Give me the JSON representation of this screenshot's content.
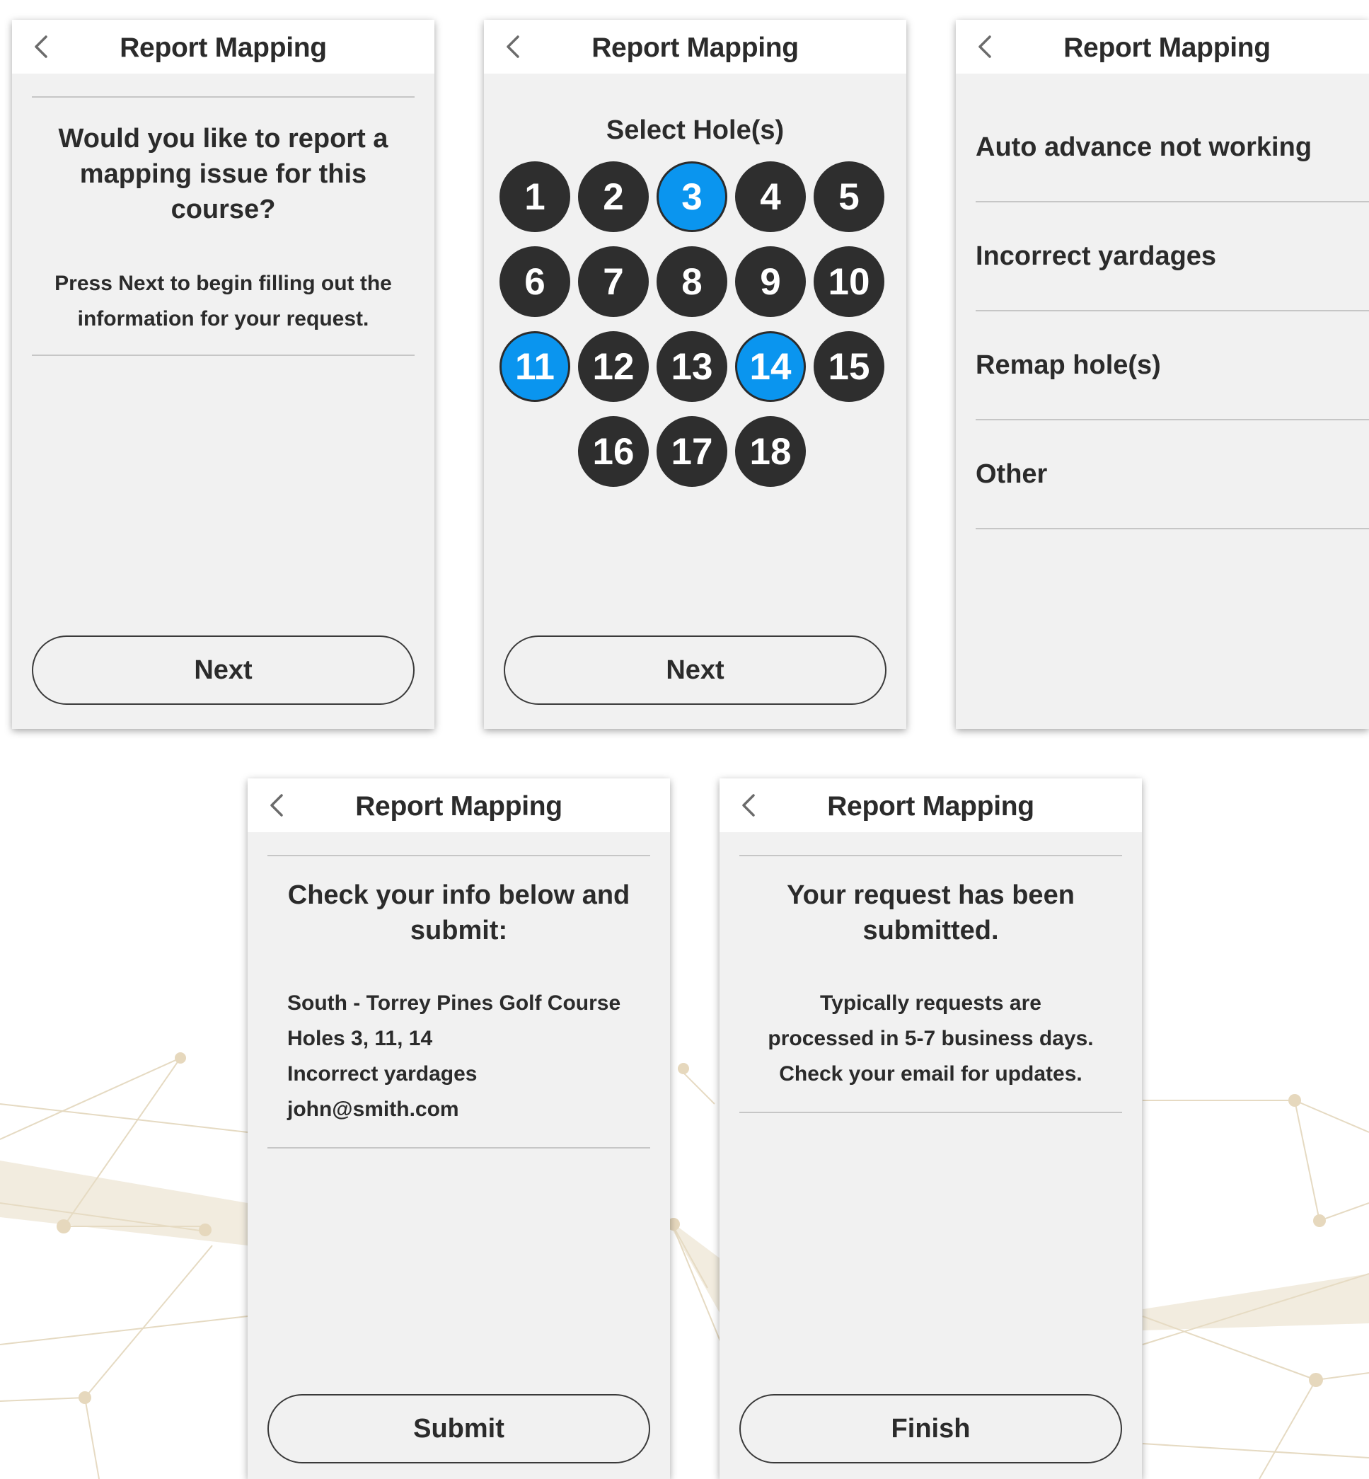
{
  "header_title": "Report Mapping",
  "screen1": {
    "question": "Would you like to report a mapping issue for this course?",
    "instructions": "Press Next to begin filling out the information for your request.",
    "next_label": "Next"
  },
  "screen2": {
    "heading": "Select Hole(s)",
    "holes": [
      "1",
      "2",
      "3",
      "4",
      "5",
      "6",
      "7",
      "8",
      "9",
      "10",
      "11",
      "12",
      "13",
      "14",
      "15",
      "16",
      "17",
      "18"
    ],
    "selected_holes": [
      "3",
      "11",
      "14"
    ],
    "next_label": "Next"
  },
  "screen3": {
    "options": [
      "Auto advance not working",
      "Incorrect yardages",
      "Remap hole(s)",
      "Other"
    ]
  },
  "screen4": {
    "heading": "Check your info below and submit:",
    "course": "South - Torrey Pines Golf Course",
    "holes": "Holes 3, 11, 14",
    "issue": "Incorrect yardages",
    "email": "john@smith.com",
    "submit_label": "Submit"
  },
  "screen5": {
    "heading": "Your request has been submitted.",
    "line1": "Typically requests are",
    "line2": "processed in 5-7 business days.",
    "line3": "Check your email for updates.",
    "finish_label": "Finish"
  },
  "colors": {
    "selected_hole": "#0a95ef",
    "hole": "#2e2e2e",
    "screen_bg": "#f1f1f1"
  }
}
